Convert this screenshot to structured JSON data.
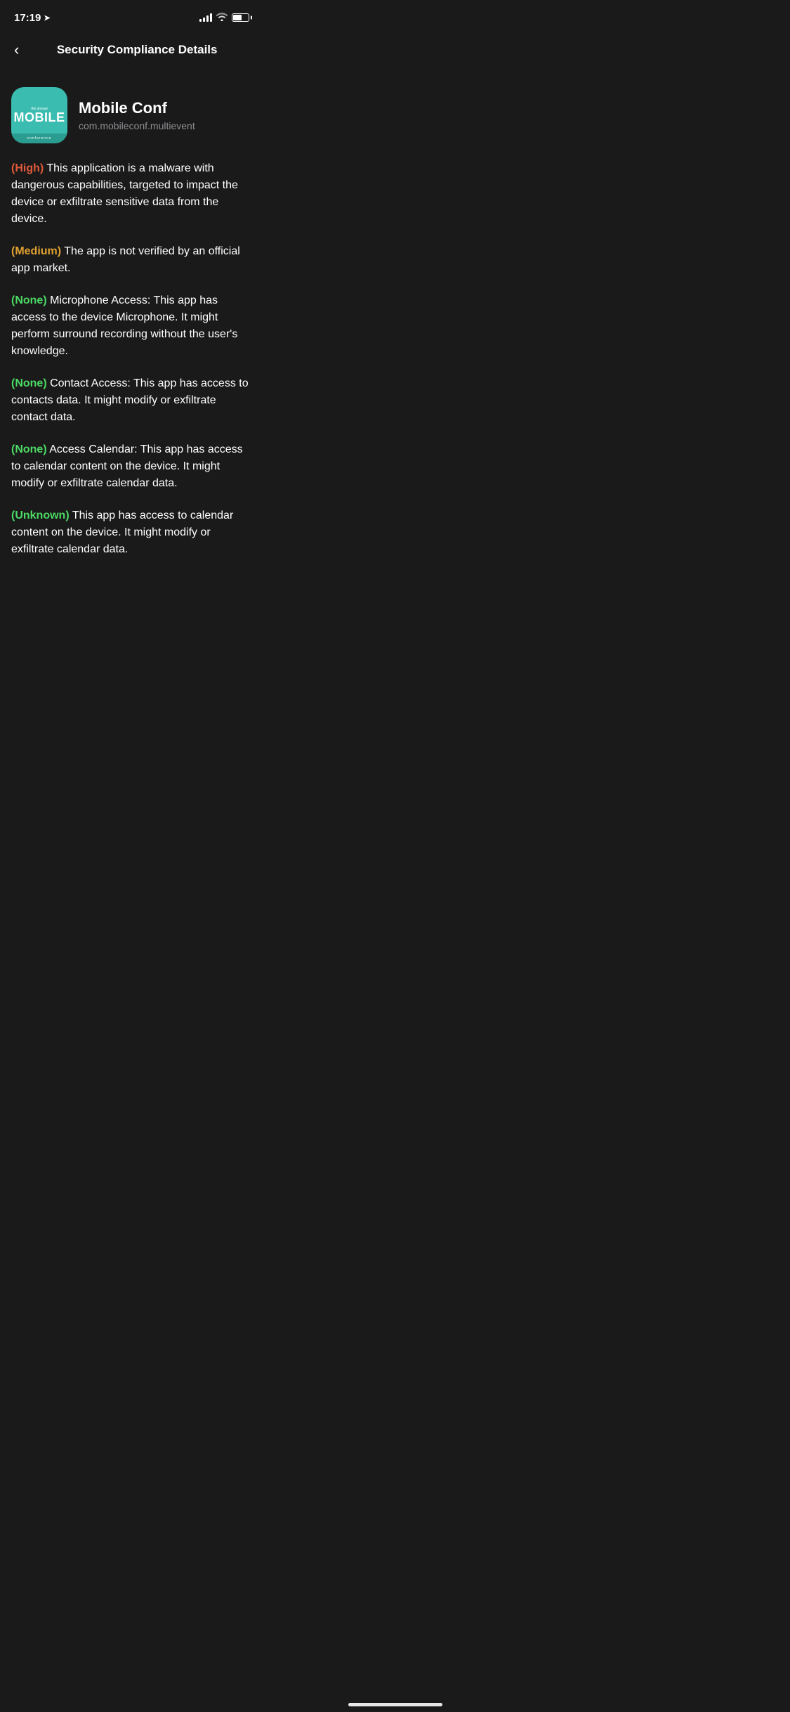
{
  "status_bar": {
    "time": "17:19",
    "location_icon": "➤"
  },
  "header": {
    "back_label": "‹",
    "title": "Security Compliance Details"
  },
  "app": {
    "name": "Mobile Conf",
    "bundle_id": "com.mobileconf.multievent",
    "icon_text_top": "the annual",
    "icon_text_main": "MOBILE",
    "icon_text_bottom": "conference"
  },
  "compliance_items": [
    {
      "severity": "High",
      "severity_class": "high",
      "text": " This application is a malware with dangerous capabilities, targeted to impact the device or exfiltrate sensitive data from the device."
    },
    {
      "severity": "Medium",
      "severity_class": "medium",
      "text": " The app is not verified by an official app market."
    },
    {
      "severity": "None",
      "severity_class": "none",
      "text": " Microphone Access: This app has access to the device Microphone. It might perform surround recording without the user's knowledge."
    },
    {
      "severity": "None",
      "severity_class": "none",
      "text": " Contact Access: This app has access to contacts data. It might modify or exfiltrate contact data."
    },
    {
      "severity": "None",
      "severity_class": "none",
      "text": " Access Calendar: This app has access to calendar content on the device. It might modify or exfiltrate calendar data."
    },
    {
      "severity": "Unknown",
      "severity_class": "unknown",
      "text": " This app has access to calendar content on the device. It might modify or exfiltrate calendar data."
    }
  ]
}
